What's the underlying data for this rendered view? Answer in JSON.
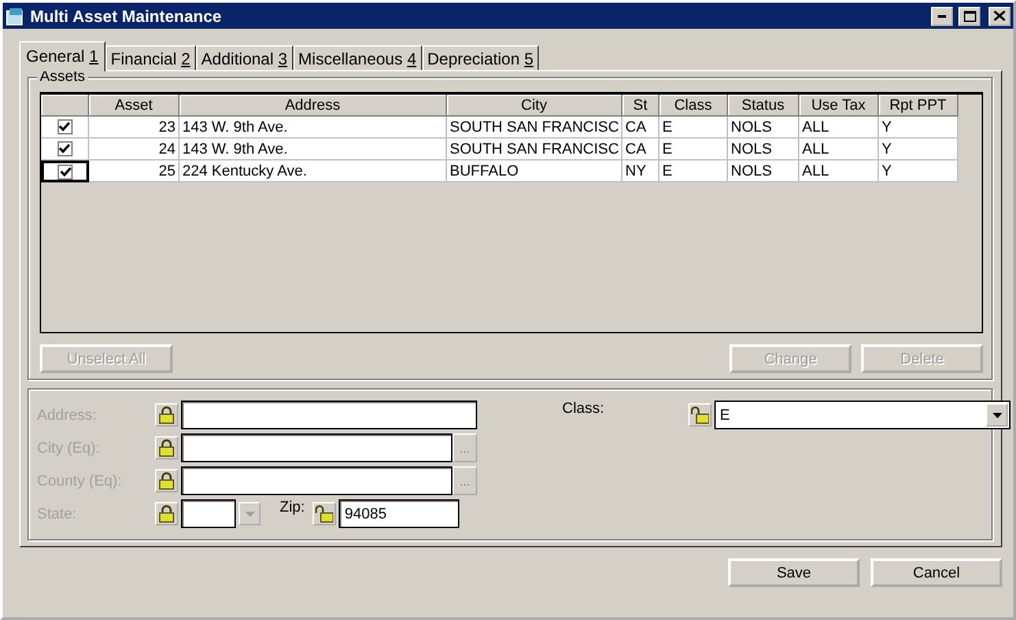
{
  "window": {
    "title": "Multi Asset Maintenance"
  },
  "tabs": [
    {
      "label": "General",
      "key": "1",
      "selected": true
    },
    {
      "label": "Financial",
      "key": "2",
      "selected": false
    },
    {
      "label": "Additional",
      "key": "3",
      "selected": false
    },
    {
      "label": "Miscellaneous",
      "key": "4",
      "selected": false
    },
    {
      "label": "Depreciation",
      "key": "5",
      "selected": false
    }
  ],
  "assets": {
    "title": "Assets",
    "columns": [
      "Asset",
      "Address",
      "City",
      "St",
      "Class",
      "Status",
      "Use Tax",
      "Rpt PPT"
    ],
    "rows": [
      {
        "checked": true,
        "focused": false,
        "cells": [
          "23",
          "143 W. 9th Ave.",
          "SOUTH SAN FRANCISC",
          "CA",
          "E",
          "NOLS",
          "ALL",
          "Y"
        ]
      },
      {
        "checked": true,
        "focused": false,
        "cells": [
          "24",
          "143 W. 9th Ave.",
          "SOUTH SAN FRANCISC",
          "CA",
          "E",
          "NOLS",
          "ALL",
          "Y"
        ]
      },
      {
        "checked": true,
        "focused": true,
        "cells": [
          "25",
          "224 Kentucky Ave.",
          "BUFFALO",
          "NY",
          "E",
          "NOLS",
          "ALL",
          "Y"
        ]
      }
    ],
    "buttons": [
      {
        "label": "Unselect All",
        "disabled": true
      },
      {
        "label": "Change",
        "disabled": true
      },
      {
        "label": "Delete",
        "disabled": true
      }
    ]
  },
  "fields": [
    {
      "kind": "text",
      "label": "Address:",
      "disabled": true,
      "locked": true
    },
    {
      "kind": "lookup",
      "label": "City (Eq):",
      "disabled": true,
      "locked": true,
      "button": "..."
    },
    {
      "kind": "lookup",
      "label": "County (Eq):",
      "disabled": true,
      "locked": true,
      "button": "..."
    },
    {
      "kind": "state",
      "label": "State:",
      "disabled": true,
      "locked": true
    }
  ],
  "zip": {
    "label": "Zip:",
    "locked": false,
    "value": "94085"
  },
  "class_field": {
    "label": "Class:",
    "locked": false,
    "value": "E"
  },
  "footer_buttons": [
    {
      "label": "Save",
      "disabled": false
    },
    {
      "label": "Cancel",
      "disabled": false
    }
  ]
}
